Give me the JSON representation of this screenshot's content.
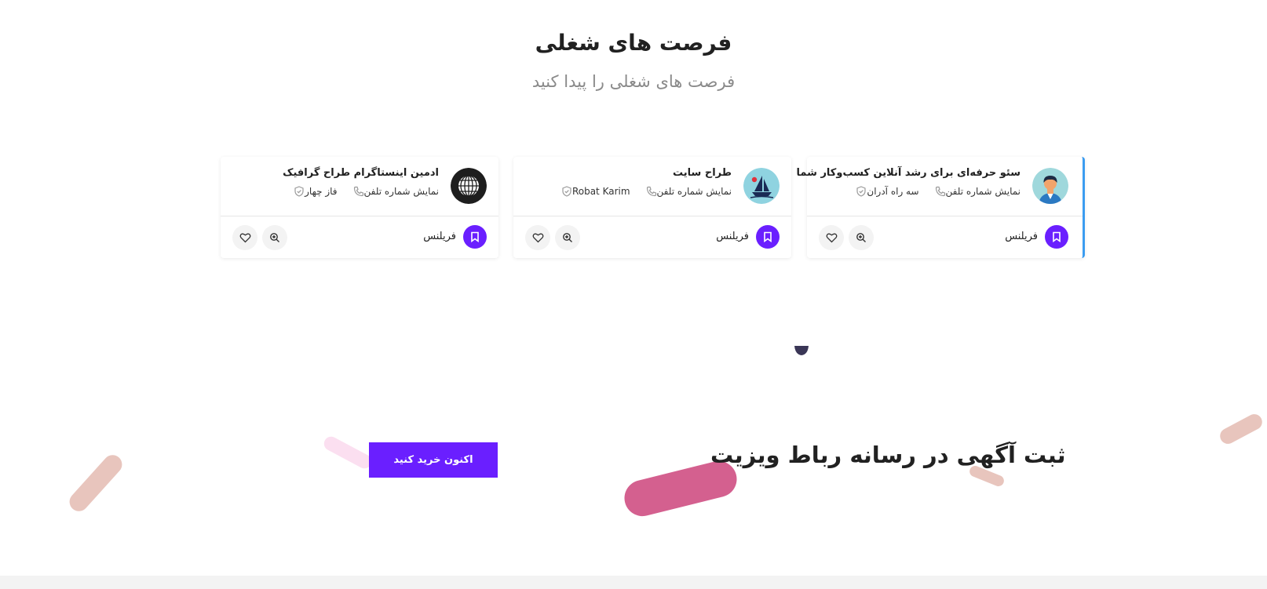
{
  "section": {
    "title": "فرصت های شغلی",
    "subtitle": "فرصت های شغلی را پیدا کنید"
  },
  "jobs": [
    {
      "title": "سئو حرفه‌ای برای رشد آنلاین کسب‌وکار شما",
      "location": "سه راه آدران",
      "phone_label": "نمایش شماره تلفن",
      "type": "فریلنس",
      "logo": "user-avatar-icon"
    },
    {
      "title": "طراح سایت",
      "location": "Robat Karim",
      "phone_label": "نمایش شماره تلفن",
      "type": "فریلنس",
      "logo": "sailboat-logo-icon"
    },
    {
      "title": "ادمین اینستاگرام طراح گرافیک",
      "location": "فاز چهار",
      "phone_label": "نمایش شماره تلفن",
      "type": "فریلنس",
      "logo": "globe-logo-icon"
    }
  ],
  "promo": {
    "title": "ثبت آگهی در رسانه رباط ویزیت",
    "button_label": "اکنون خرید کنید"
  },
  "colors": {
    "accent": "#6a1fff",
    "active_border": "#3b9cf0",
    "pink_shape": "#d4608f",
    "beige_shape": "#e8c5bd",
    "light_pink_shape": "#fbdff0"
  }
}
